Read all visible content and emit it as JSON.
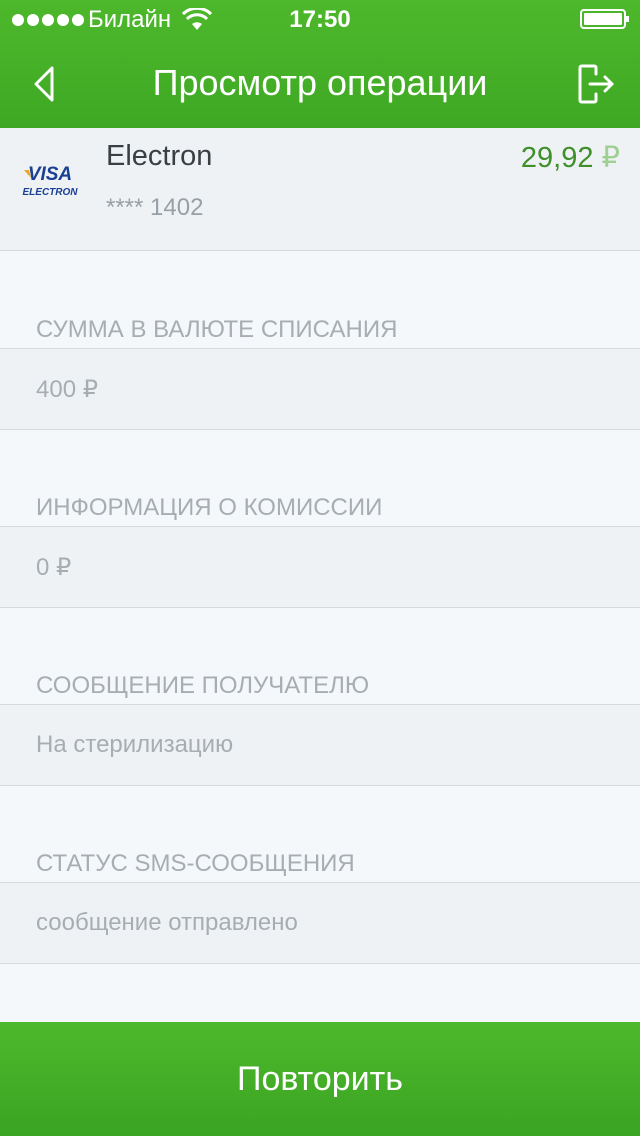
{
  "status_bar": {
    "carrier": "Билайн",
    "time": "17:50",
    "signal_icon": "signal-dots-icon",
    "wifi_icon": "wifi-icon",
    "battery_icon": "battery-icon"
  },
  "header": {
    "title": "Просмотр операции",
    "back_icon": "chevron-left-icon",
    "exit_icon": "logout-icon",
    "color": "#4eb82c"
  },
  "card": {
    "logo_line1": "VISA",
    "logo_line2": "ELECTRON",
    "name": "Electron",
    "number": "**** 1402",
    "balance": "29,92",
    "currency": "₽"
  },
  "fields": [
    {
      "label": "СУММА В ВАЛЮТЕ СПИСАНИЯ",
      "value": "400 ₽"
    },
    {
      "label": "ИНФОРМАЦИЯ О КОМИССИИ",
      "value": "0 ₽"
    },
    {
      "label": "СООБЩЕНИЕ ПОЛУЧАТЕЛЮ",
      "value": "На стерилизацию"
    },
    {
      "label": "СТАТУС SMS-СООБЩЕНИЯ",
      "value": "сообщение отправлено"
    }
  ],
  "footer": {
    "repeat_label": "Повторить"
  }
}
